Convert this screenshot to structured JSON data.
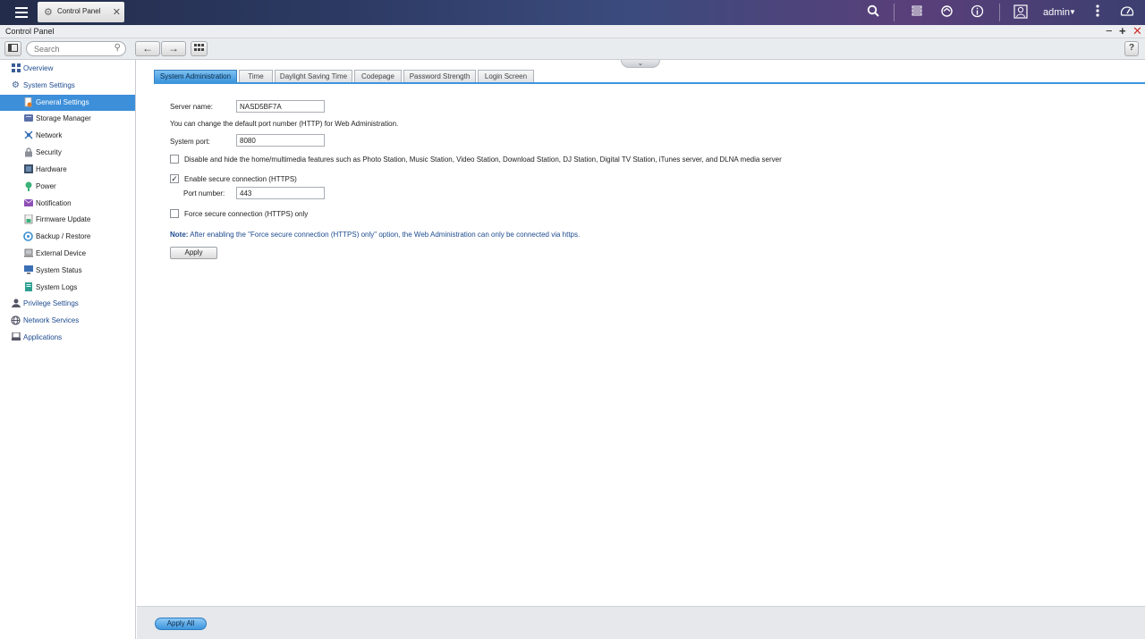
{
  "topbar": {
    "app_tab_label": "Control Panel",
    "user_name": "admin",
    "icons": [
      "search-icon",
      "stack-icon",
      "sync-icon",
      "info-icon",
      "user-icon",
      "more-icon",
      "dashboard-icon"
    ]
  },
  "window": {
    "title": "Control Panel"
  },
  "toolbar": {
    "search_placeholder": "Search",
    "help_label": "?"
  },
  "sidebar": {
    "items": [
      {
        "label": "Overview",
        "level": "top",
        "icon": "grid-icon"
      },
      {
        "label": "System Settings",
        "level": "top",
        "icon": "gear-icon"
      },
      {
        "label": "General Settings",
        "level": "sub",
        "icon": "settings-file-icon",
        "active": true
      },
      {
        "label": "Storage Manager",
        "level": "sub",
        "icon": "storage-icon"
      },
      {
        "label": "Network",
        "level": "sub",
        "icon": "network-icon"
      },
      {
        "label": "Security",
        "level": "sub",
        "icon": "lock-icon"
      },
      {
        "label": "Hardware",
        "level": "sub",
        "icon": "hardware-icon"
      },
      {
        "label": "Power",
        "level": "sub",
        "icon": "power-icon"
      },
      {
        "label": "Notification",
        "level": "sub",
        "icon": "notification-icon"
      },
      {
        "label": "Firmware Update",
        "level": "sub",
        "icon": "firmware-icon"
      },
      {
        "label": "Backup / Restore",
        "level": "sub",
        "icon": "backup-icon"
      },
      {
        "label": "External Device",
        "level": "sub",
        "icon": "external-device-icon"
      },
      {
        "label": "System Status",
        "level": "sub",
        "icon": "monitor-icon"
      },
      {
        "label": "System Logs",
        "level": "sub",
        "icon": "logs-icon"
      },
      {
        "label": "Privilege Settings",
        "level": "top",
        "icon": "user-icon"
      },
      {
        "label": "Network Services",
        "level": "top",
        "icon": "globe-icon"
      },
      {
        "label": "Applications",
        "level": "top",
        "icon": "applications-icon"
      }
    ]
  },
  "tabs": [
    {
      "label": "System Administration",
      "active": true
    },
    {
      "label": "Time"
    },
    {
      "label": "Daylight Saving Time"
    },
    {
      "label": "Codepage"
    },
    {
      "label": "Password Strength"
    },
    {
      "label": "Login Screen"
    }
  ],
  "form": {
    "server_name_label": "Server name:",
    "server_name_value": "NASD5BF7A",
    "port_info": "You can change the default port number (HTTP) for Web Administration.",
    "system_port_label": "System port:",
    "system_port_value": "8080",
    "disable_multimedia_label": "Disable and hide the home/multimedia features such as Photo Station, Music Station, Video Station, Download Station, DJ Station, Digital TV Station, iTunes server, and DLNA media server",
    "disable_multimedia_checked": false,
    "enable_https_label": "Enable secure connection (HTTPS)",
    "enable_https_checked": true,
    "port_number_label": "Port number:",
    "port_number_value": "443",
    "force_https_label": "Force secure connection (HTTPS) only",
    "force_https_checked": false,
    "note_prefix": "Note:",
    "note_text": "After enabling the \"Force secure connection (HTTPS) only\" option, the Web Administration can only be connected via https.",
    "apply_label": "Apply"
  },
  "footer": {
    "apply_all_label": "Apply All"
  }
}
